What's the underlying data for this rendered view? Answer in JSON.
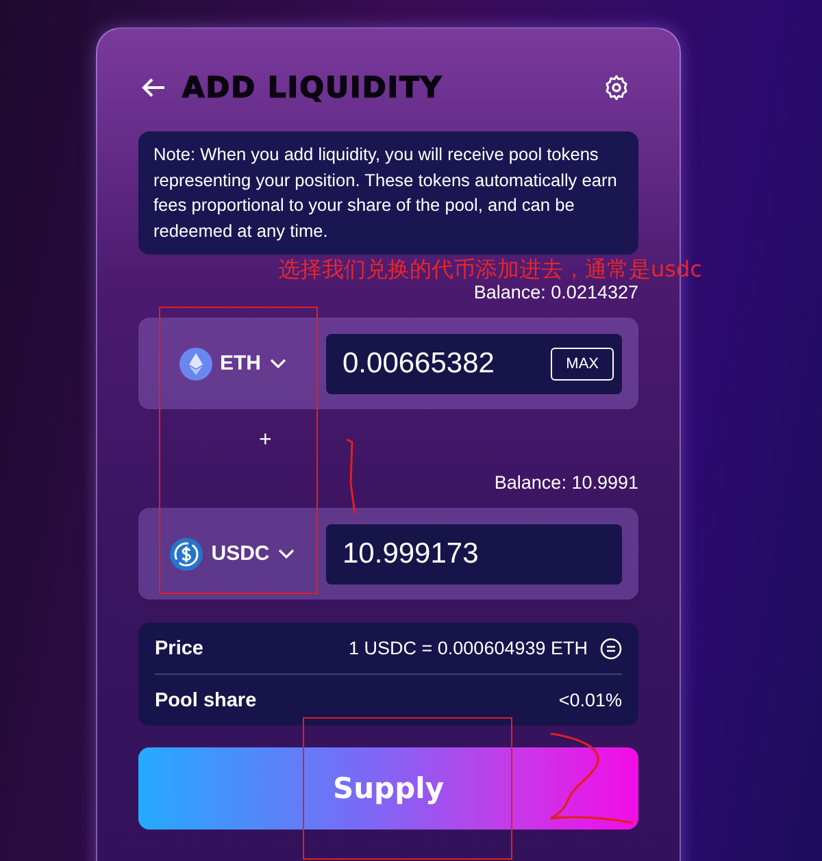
{
  "header": {
    "title": "ADD LIQUIDITY"
  },
  "note": "Note: When you add liquidity, you will receive pool tokens representing your position. These tokens automatically earn fees proportional to your share of the pool, and can be redeemed at any time.",
  "tokens": [
    {
      "kind": "eth",
      "symbol": "ETH",
      "amount": "0.00665382",
      "balance": "Balance: 0.0214327",
      "max_label": "MAX"
    },
    {
      "kind": "usdc",
      "symbol": "USDC",
      "amount": "10.999173",
      "balance": "Balance: 10.9991"
    }
  ],
  "plus": "+",
  "details": [
    {
      "kind": "price",
      "label": "Price",
      "value": "1 USDC = 0.000604939 ETH"
    },
    {
      "kind": "share",
      "label": "Pool share",
      "value": "<0.01%"
    }
  ],
  "supply_button": "Supply",
  "annotation": {
    "text": "选择我们兑换的代币添加进去，通常是usdc"
  }
}
